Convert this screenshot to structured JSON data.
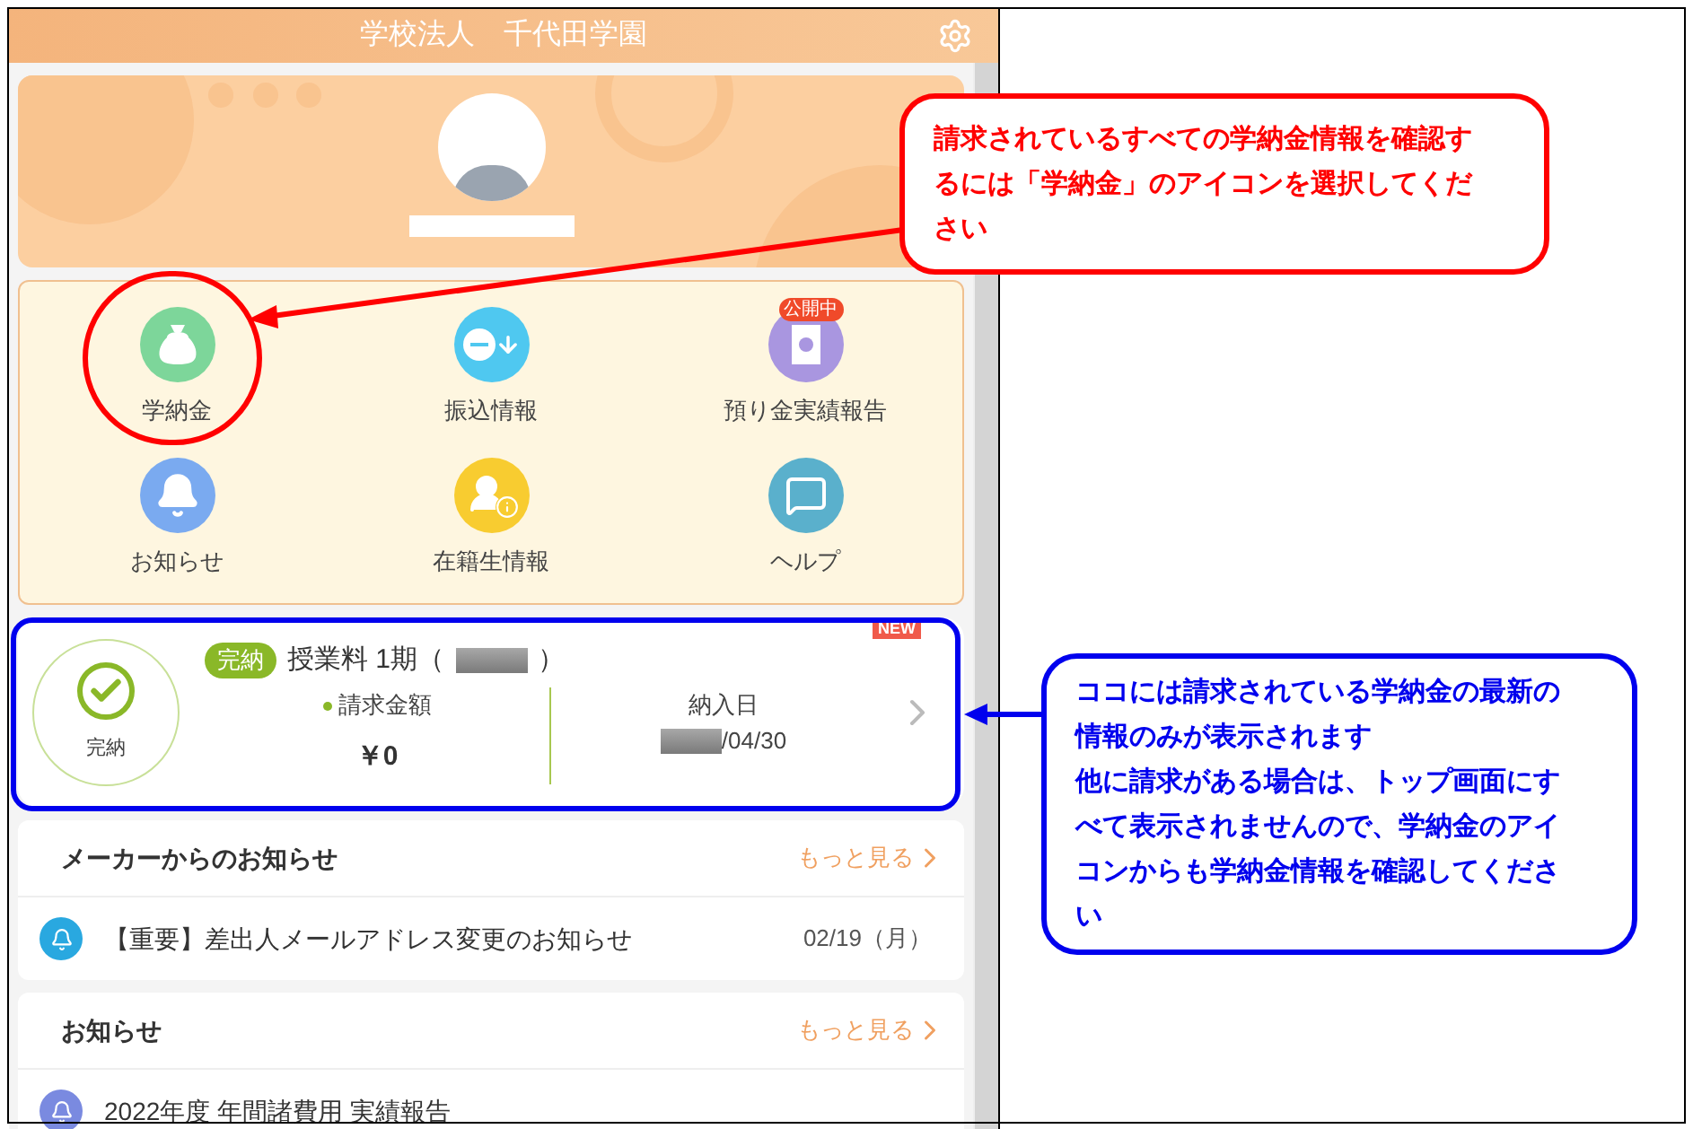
{
  "header": {
    "title": "学校法人　千代田学園"
  },
  "menu": [
    {
      "kind": "money-bag",
      "label": "学納金",
      "color": "#7dd69a"
    },
    {
      "kind": "transfer",
      "label": "振込情報",
      "color": "#4fc8f0"
    },
    {
      "kind": "report",
      "label": "預り金実績報告",
      "color": "#a996e0",
      "badge": "公開中"
    },
    {
      "kind": "bell",
      "label": "お知らせ",
      "color": "#7aaaf0"
    },
    {
      "kind": "student",
      "label": "在籍生情報",
      "color": "#f8cc30"
    },
    {
      "kind": "help",
      "label": "ヘルプ",
      "color": "#5ab0cc"
    }
  ],
  "payment": {
    "status": "完納",
    "status_badge": "完納",
    "title_prefix": "授業料 1期（",
    "title_suffix": "）",
    "new_badge": "NEW",
    "amount_label": "請求金額",
    "amount": "￥0",
    "date_label": "納入日",
    "date_suffix": "/04/30"
  },
  "sections": [
    {
      "title": "メーカーからのお知らせ",
      "more": "もっと見る",
      "items": [
        {
          "text": "【重要】差出人メールアドレス変更のお知らせ",
          "date": "02/19（月）",
          "color": "#29a8e0"
        }
      ]
    },
    {
      "title": "お知らせ",
      "more": "もっと見る",
      "items": [
        {
          "text": "2022年度 年間諸費用 実績報告",
          "color": "#7a8ae0"
        }
      ]
    }
  ],
  "callouts": [
    {
      "paragraphs": [
        "請求されているすべての学納金情報を確認するには「学納金」のアイコンを選択してください"
      ],
      "color": "#ff0000"
    },
    {
      "paragraphs": [
        "ココには請求されている学納金の最新の情報のみが表示されます",
        "他に請求がある場合は、トップ画面にすべて表示されませんので、学納金のアイコンからも学納金情報を確認してください"
      ],
      "color": "#0000ee"
    }
  ]
}
